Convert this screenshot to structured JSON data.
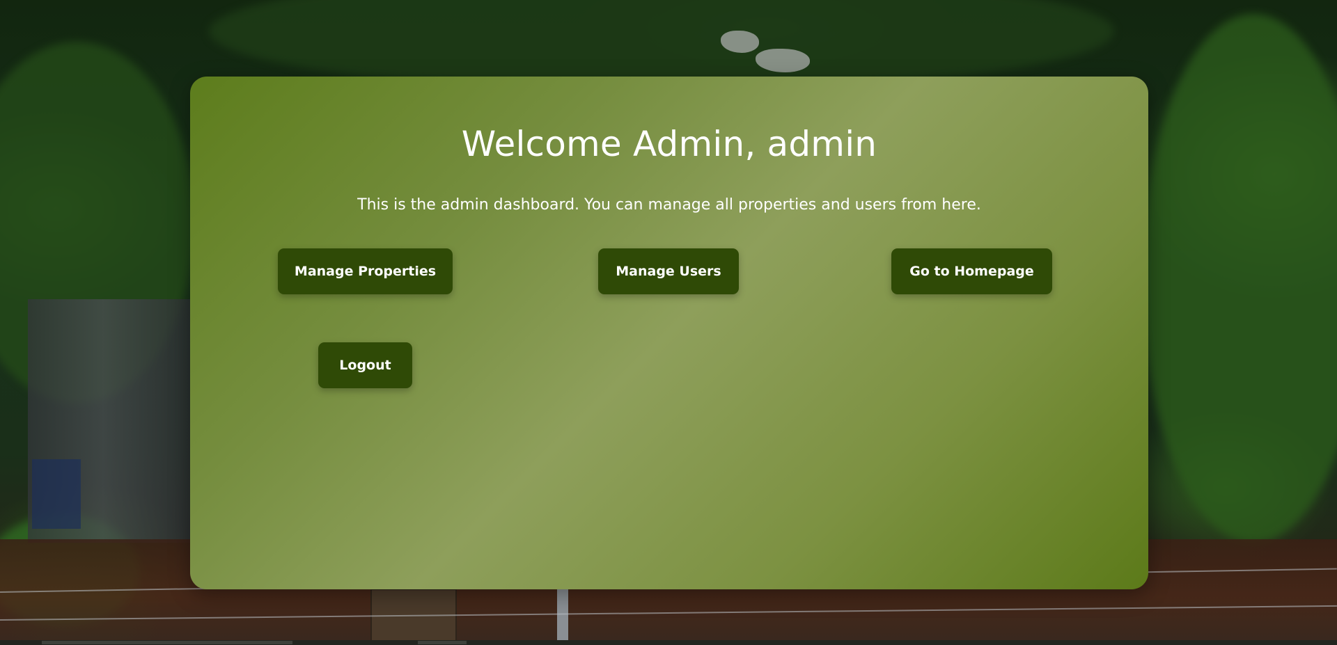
{
  "dashboard": {
    "title": "Welcome Admin, admin",
    "subtitle": "This is the admin dashboard. You can manage all properties and users from here.",
    "buttons": {
      "manage_properties": "Manage Properties",
      "manage_users": "Manage Users",
      "go_to_homepage": "Go to Homepage",
      "logout": "Logout"
    }
  },
  "colors": {
    "card_gradient": [
      "#5d7d1c",
      "#8e9f5b",
      "#5c7a19"
    ],
    "button_background": "#2f4a06",
    "text": "#ffffff"
  }
}
